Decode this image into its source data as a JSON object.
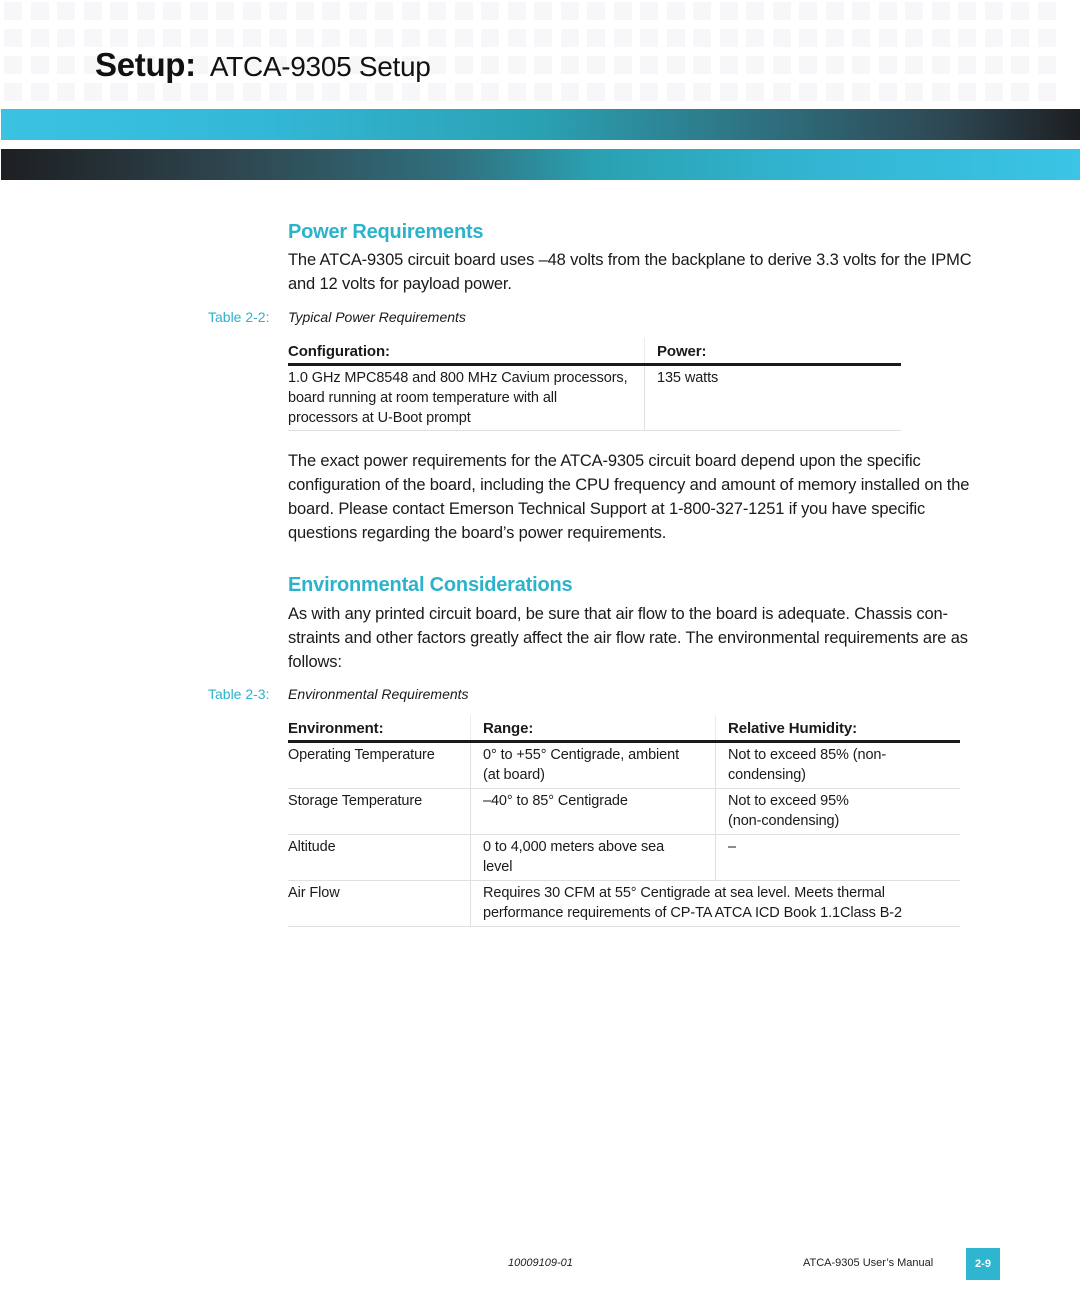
{
  "header": {
    "title_bold": "Setup:",
    "title_rest": "ATCA-9305 Setup"
  },
  "colors": {
    "accent": "#2cb3cc",
    "band_light": "#3bc2e3",
    "band_dark": "#1d1f22"
  },
  "power_section": {
    "heading": "Power Requirements",
    "intro": "The ATCA-9305 circuit board uses –48 volts from the backplane to derive 3.3 volts for the IPMC and 12 volts for payload power.",
    "table_caption_num": "Table 2-2:",
    "table_caption_title": "Typical Power Requirements",
    "table": {
      "headers": [
        "Configuration:",
        "Power:"
      ],
      "rows": [
        [
          "1.0 GHz MPC8548 and 800 MHz Cavium processors, board running at room temperature with all processors at U-Boot prompt",
          "135 watts"
        ]
      ]
    },
    "followup": "The exact power requirements for the ATCA-9305 circuit board depend upon the specific configuration of the board, including the CPU frequency and amount of memory installed on the board. Please contact Emerson Technical Support at 1-800-327-1251 if you have specific questions regarding the board’s power requirements."
  },
  "env_section": {
    "heading": "Environmental Considerations",
    "intro": "As with any printed circuit board, be sure that air flow to the board is adequate. Chassis con-straints and other factors greatly affect the air flow rate. The environmental requirements are as follows:",
    "table_caption_num": "Table 2-3:",
    "table_caption_title": "Environmental Requirements",
    "table": {
      "headers": [
        "Environment:",
        "Range:",
        "Relative Humidity:"
      ],
      "rows": [
        [
          "Operating Temperature",
          "0° to +55° Centigrade, ambient (at board)",
          "Not to exceed 85% (non-condensing)"
        ],
        [
          "Storage Temperature",
          "–40° to 85° Centigrade",
          "Not to exceed 95% (non-condensing)"
        ],
        [
          "Altitude",
          "0 to 4,000 meters above sea level",
          "–"
        ]
      ],
      "airflow_row": {
        "label": "Air Flow",
        "value": "Requires 30 CFM at 55° Centigrade at sea level. Meets thermal performance requirements of CP-TA ATCA ICD Book 1.1Class B-2"
      }
    }
  },
  "footer": {
    "doc_number": "10009109-01",
    "manual_title": "ATCA-9305 User’s Manual",
    "page_number": "2-9"
  }
}
